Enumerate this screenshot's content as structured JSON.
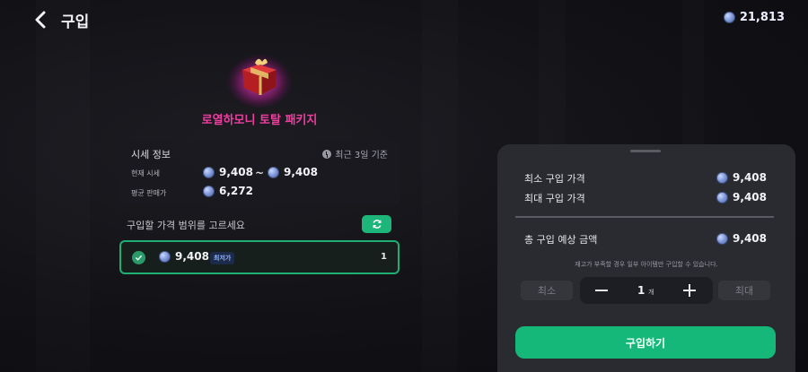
{
  "header": {
    "title": "구입",
    "balance": "21,813"
  },
  "product": {
    "name": "로열하모니 토탈 패키지"
  },
  "market": {
    "title": "시세 정보",
    "period": "최근 3일 기준",
    "current_label": "현재 시세",
    "current_min": "9,408",
    "current_max": "9,408",
    "range_sep": "~",
    "avg_label": "평균 판매가",
    "avg_value": "6,272"
  },
  "range": {
    "label": "구입할 가격 범위를 고르세요"
  },
  "option": {
    "price": "9,408",
    "badge": "최저가",
    "quantity": "1"
  },
  "panel": {
    "min_label": "최소 구입 가격",
    "min_value": "9,408",
    "max_label": "최대 구입 가격",
    "max_value": "9,408",
    "total_label": "총 구입 예상 금액",
    "total_value": "9,408",
    "notice": "재고가 부족할 경우 일부 아이템만 구입할 수 있습니다.",
    "min_btn": "최소",
    "max_btn": "최대",
    "qty": "1",
    "qty_unit": "개",
    "buy_btn": "구입하기"
  },
  "colors": {
    "accent_green": "#16b879",
    "product_name": "#ee3f9f",
    "badge_text": "#8fb0ff"
  },
  "icons": [
    "back-arrow-icon",
    "coin-icon",
    "gift-box-icon",
    "clock-icon",
    "refresh-icon",
    "check-icon",
    "minus-icon",
    "plus-icon"
  ]
}
